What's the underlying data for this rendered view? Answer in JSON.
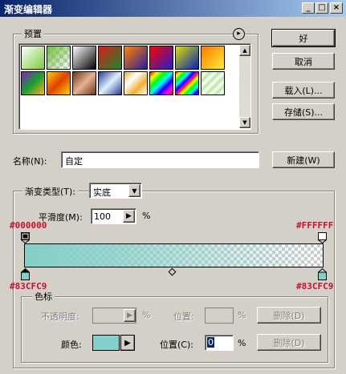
{
  "window": {
    "title": "渐变编辑器",
    "minimize": "_",
    "maximize": "□",
    "close": "×"
  },
  "presets": {
    "label": "预置",
    "menu_glyph": "▸"
  },
  "buttons": {
    "ok": "好",
    "cancel": "取消",
    "load": "载入(L)...",
    "save": "存储(S)...",
    "new": "新建(W)"
  },
  "name": {
    "label": "名称(N):",
    "value": "自定"
  },
  "gradient": {
    "group_label": "渐变类型(T):",
    "type_value": "实底",
    "smoothness_label": "平滑度(M):",
    "smoothness_value": "100",
    "smoothness_unit": "%",
    "left_opacity_color_label": "#000000",
    "right_opacity_color_label": "#FFFFFF",
    "left_stop_label": "#83CFC9",
    "right_stop_label": "#83CFC9",
    "bar_color": "#83cfc9"
  },
  "stops": {
    "group_label": "色标",
    "opacity_label": "不透明度:",
    "opacity_unit": "%",
    "location1_label": "位置:",
    "location1_unit": "%",
    "delete1": "删除(D)",
    "color_label": "颜色:",
    "location2_label": "位置(C):",
    "location2_value": "0",
    "location2_unit": "%",
    "delete2": "删除(D)",
    "color_value": "#83cfc9"
  }
}
